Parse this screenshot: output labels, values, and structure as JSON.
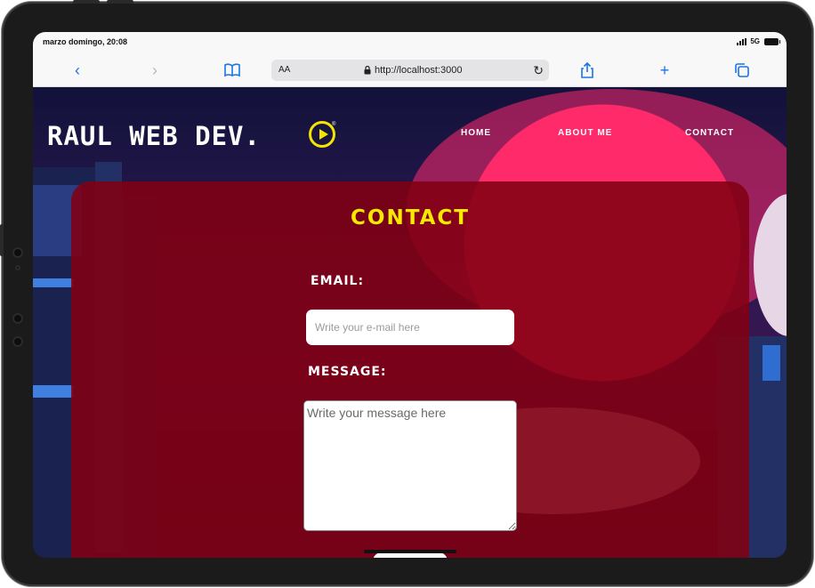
{
  "status_bar": {
    "time": "marzo domingo, 20:08",
    "network": "5G"
  },
  "browser": {
    "aa_label": "AA",
    "url": "http://localhost:3000",
    "icons": [
      "back-icon",
      "forward-icon",
      "bookmarks-icon",
      "lock-icon",
      "reload-icon",
      "share-icon",
      "new-tab-icon",
      "tabs-icon"
    ]
  },
  "site": {
    "logo": "RAUL WEB DEV.",
    "logo_mark": "®",
    "nav": [
      {
        "label": "HOME"
      },
      {
        "label": "ABOUT ME"
      },
      {
        "label": "CONTACT"
      }
    ]
  },
  "contact": {
    "title": "CONTACT",
    "email_label": "EMAIL:",
    "email_placeholder": "Write your e-mail here",
    "message_label": "MESSAGE:",
    "message_placeholder": "Write your message here"
  },
  "colors": {
    "accent_yellow": "#f7ea00",
    "panel_red": "#820012",
    "browser_blue": "#1a73e8"
  }
}
